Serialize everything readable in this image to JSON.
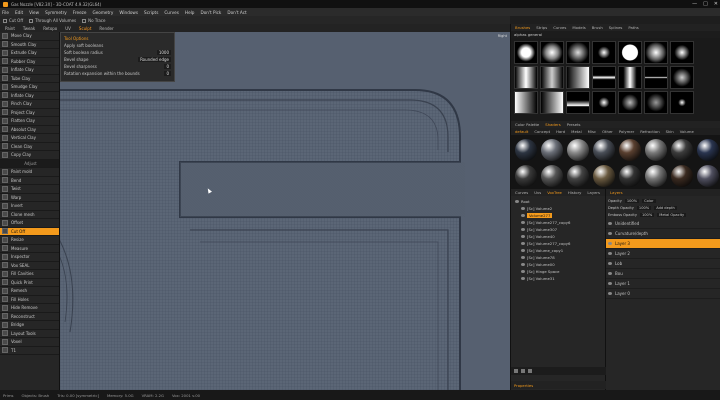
{
  "window": {
    "title": "Gas Nozzle [V82.3X] - 3D-COAT 4.9.32(GL64)",
    "controls": [
      "—",
      "□",
      "✕"
    ]
  },
  "menu": [
    "File",
    "Edit",
    "View",
    "Symmetry",
    "Freeze",
    "Geometry",
    "Windows",
    "Scripts",
    "Curves",
    "Help",
    "Don't Pick",
    "Don't Act"
  ],
  "toolbar": {
    "items": [
      "Cut Off",
      "Through All Volumes",
      "No Trace"
    ]
  },
  "room_tabs": {
    "items": [
      "Paint",
      "Tweak",
      "Retopo",
      "UV",
      "Sculpt",
      "Render"
    ],
    "active": "Sculpt"
  },
  "left_tools": [
    {
      "label": "Move Clay"
    },
    {
      "label": "Smooth Clay"
    },
    {
      "label": "Extrude Clay"
    },
    {
      "label": "Rubber Clay"
    },
    {
      "label": "Inflate Clay"
    },
    {
      "label": "Tube Clay"
    },
    {
      "label": "Smudge Clay"
    },
    {
      "label": "Inflate Clay"
    },
    {
      "label": "Pinch Clay"
    },
    {
      "label": "Project Clay"
    },
    {
      "label": "Flatten Clay"
    },
    {
      "label": "Absolut Clay"
    },
    {
      "label": "Vertical Clay"
    },
    {
      "label": "Clean Clay"
    },
    {
      "label": "Copy Clay"
    },
    {
      "label": "Adjust",
      "header": true
    },
    {
      "label": "Paint mold"
    },
    {
      "label": "Bend"
    },
    {
      "label": "Twist"
    },
    {
      "label": "Warp"
    },
    {
      "label": "Invert"
    },
    {
      "label": "Clone mesh"
    },
    {
      "label": "Offset"
    },
    {
      "label": "Cut Off",
      "active": true
    },
    {
      "label": "Resize"
    },
    {
      "label": "Measure"
    },
    {
      "label": "Inspector"
    },
    {
      "label": "Vox SEAL"
    },
    {
      "label": "Fill Cavities"
    },
    {
      "label": "Quick Print"
    },
    {
      "label": "Remesh"
    },
    {
      "label": "Fill Holes"
    },
    {
      "label": "Hide Remove"
    },
    {
      "label": "Reconstruct"
    },
    {
      "label": "Bridge"
    },
    {
      "label": "Layout Tools"
    },
    {
      "label": "Voxel"
    },
    {
      "label": "T1"
    }
  ],
  "tool_options": {
    "header": "Tool Options",
    "rows": [
      {
        "label": "Apply soft booleans",
        "value": ""
      },
      {
        "label": "Soft boolean radius",
        "value": "1000"
      },
      {
        "label": "Bevel shape",
        "value": "Rounded edge"
      },
      {
        "label": "Bevel sharpness",
        "value": "0"
      },
      {
        "label": "Rotation expansion within the bounds",
        "value": "0"
      }
    ]
  },
  "viewport": {
    "label": "Right"
  },
  "right_panel": {
    "brush_tabs": {
      "items": [
        "Brushes",
        "Strips",
        "Curves",
        "Models",
        "Brush",
        "Splines",
        "Paths"
      ],
      "active": "Brushes"
    },
    "brush_search": "alphas general",
    "material_tabs": {
      "items": [
        "Color Palette",
        "Shaders",
        "Presets"
      ],
      "active": "Shaders"
    },
    "material_subtabs": {
      "items": [
        "default",
        "Concept",
        "Hard",
        "Metal",
        "Misc",
        "Other",
        "Polymer",
        "Refraction",
        "Skin",
        "Volume"
      ],
      "active": "default"
    },
    "scene_tabs": {
      "items": [
        "Curves",
        "Uvs",
        "VoxTree",
        "History",
        "Layers"
      ],
      "active": "VoxTree"
    },
    "scene_items": [
      {
        "label": "Root",
        "indent": 0
      },
      {
        "label": "[Sc] Volume2",
        "indent": 1
      },
      {
        "label": "Volume277",
        "indent": 1,
        "selected": true
      },
      {
        "label": "[Sc] Volume277_copy6",
        "indent": 1
      },
      {
        "label": "[Sc] Volume307",
        "indent": 1
      },
      {
        "label": "[Sc] Volume40",
        "indent": 1
      },
      {
        "label": "[Sc] Volume277_copy6",
        "indent": 1
      },
      {
        "label": "[Sc] Volume_copy1",
        "indent": 1
      },
      {
        "label": "[Sc] Volume78",
        "indent": 1
      },
      {
        "label": "[Sc] Volume00",
        "indent": 1
      },
      {
        "label": "[Sc] Hinge Space",
        "indent": 1
      },
      {
        "label": "[Sc] Volume31",
        "indent": 1
      }
    ],
    "layers_header": "Layers",
    "layer_props": [
      {
        "label": "Opacity",
        "value": "100%",
        "extra": "Color"
      },
      {
        "label": "Depth Opacity",
        "value": "100%",
        "extra": "Add depth"
      },
      {
        "label": "Emboss Opacity",
        "value": "100%",
        "extra": "Metal Opacity"
      }
    ],
    "layers": [
      {
        "label": "Unidentified"
      },
      {
        "label": "Curvature/depth"
      },
      {
        "label": "Layer 3",
        "selected": true
      },
      {
        "label": "Layer 2"
      },
      {
        "label": "Lob"
      },
      {
        "label": "Bou"
      },
      {
        "label": "Layer 1"
      },
      {
        "label": "Layer 0"
      }
    ],
    "props_label": "Properties",
    "prop_row": {
      "label": "Formnate",
      "value": "32"
    }
  },
  "statusbar": {
    "items": [
      "Prims",
      "Objects: Brush",
      "Tris: 0.00 [symmetric]",
      "Memory: 5.0G",
      "VRAM: 2.2G",
      "Vox: 2001 v.00"
    ]
  }
}
